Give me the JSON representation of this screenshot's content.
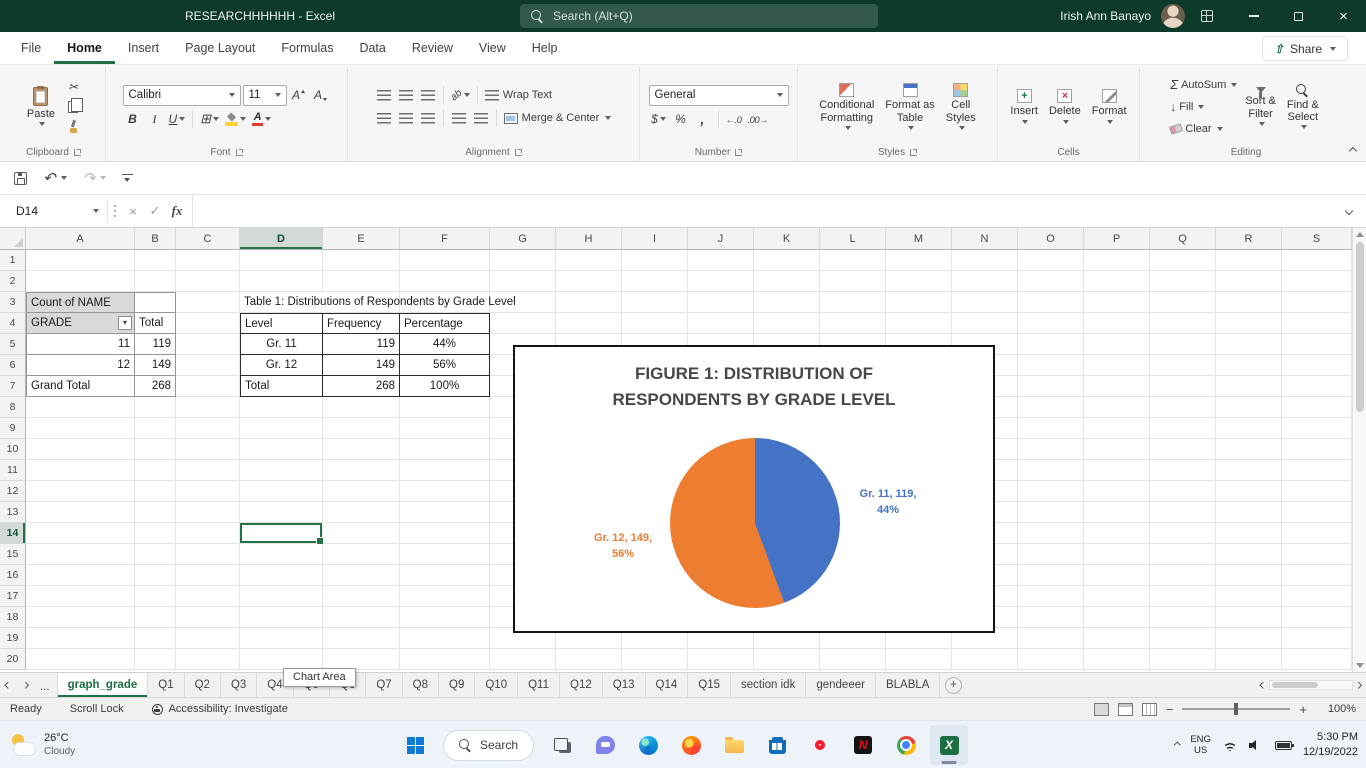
{
  "titlebar": {
    "title": "RESEARCHHHHHH  -  Excel",
    "search": "Search (Alt+Q)",
    "user": "Irish Ann Banayo"
  },
  "menu": {
    "tabs": [
      "File",
      "Home",
      "Insert",
      "Page Layout",
      "Formulas",
      "Data",
      "Review",
      "View",
      "Help"
    ],
    "active": "Home",
    "share": "Share"
  },
  "ribbon": {
    "paste": "Paste",
    "font_name": "Calibri",
    "font_size": "11",
    "wrap_text": "Wrap Text",
    "merge_center": "Merge & Center",
    "number_format": "General",
    "conditional_formatting": "Conditional\nFormatting",
    "format_as_table": "Format as\nTable",
    "cell_styles": "Cell\nStyles",
    "insert": "Insert",
    "delete": "Delete",
    "format": "Format",
    "autosum": "AutoSum",
    "fill": "Fill",
    "clear": "Clear",
    "sort_filter": "Sort &\nFilter",
    "find_select": "Find &\nSelect",
    "groups": {
      "clipboard": "Clipboard",
      "font": "Font",
      "alignment": "Alignment",
      "number": "Number",
      "styles": "Styles",
      "cells": "Cells",
      "editing": "Editing"
    }
  },
  "formula_bar": {
    "name_box": "D14"
  },
  "grid": {
    "columns": [
      "A",
      "B",
      "C",
      "D",
      "E",
      "F",
      "G",
      "H",
      "I",
      "J",
      "K",
      "L",
      "M",
      "N",
      "O",
      "P",
      "Q",
      "R",
      "S"
    ],
    "row_count": 20,
    "selected": {
      "col": "D",
      "row": 14
    },
    "cells": [
      {
        "ref": "A3",
        "text": "Count of NAME",
        "cls": "pv t l gray"
      },
      {
        "ref": "B3",
        "text": "",
        "cls": "pv t"
      },
      {
        "ref": "A4",
        "text": "GRADE",
        "cls": "pv l gray filter"
      },
      {
        "ref": "B4",
        "text": "Total",
        "cls": "pv"
      },
      {
        "ref": "A5",
        "text": "11",
        "cls": "pv l num"
      },
      {
        "ref": "B5",
        "text": "119",
        "cls": "pv num"
      },
      {
        "ref": "A6",
        "text": "12",
        "cls": "pv l num"
      },
      {
        "ref": "B6",
        "text": "149",
        "cls": "pv num"
      },
      {
        "ref": "A7",
        "text": "Grand Total",
        "cls": "pv l"
      },
      {
        "ref": "B7",
        "text": "268",
        "cls": "pv num"
      },
      {
        "ref": "D3",
        "text": "Table 1: Distributions of Respondents by Grade Level",
        "cls": "spill"
      },
      {
        "ref": "D4",
        "text": "Level",
        "cls": "tbl t l"
      },
      {
        "ref": "E4",
        "text": "Frequency",
        "cls": "tbl t"
      },
      {
        "ref": "F4",
        "text": "Percentage",
        "cls": "tbl t"
      },
      {
        "ref": "D5",
        "text": "Gr. 11",
        "cls": "tbl l center"
      },
      {
        "ref": "E5",
        "text": "119",
        "cls": "tbl num"
      },
      {
        "ref": "F5",
        "text": "44%",
        "cls": "tbl center"
      },
      {
        "ref": "D6",
        "text": "Gr. 12",
        "cls": "tbl l center"
      },
      {
        "ref": "E6",
        "text": "149",
        "cls": "tbl num"
      },
      {
        "ref": "F6",
        "text": "56%",
        "cls": "tbl center"
      },
      {
        "ref": "D7",
        "text": "Total",
        "cls": "tbl l"
      },
      {
        "ref": "E7",
        "text": "268",
        "cls": "tbl num"
      },
      {
        "ref": "F7",
        "text": "100%",
        "cls": "tbl center"
      }
    ]
  },
  "chart_data": {
    "type": "pie",
    "title": "FIGURE 1: DISTRIBUTION OF RESPONDENTS BY GRADE LEVEL",
    "categories": [
      "Gr. 11",
      "Gr. 12"
    ],
    "values": [
      119,
      149
    ],
    "percentages": [
      "44%",
      "56%"
    ],
    "colors": [
      "#4472C4",
      "#ED7D31"
    ],
    "legend_position": "none",
    "labels": {
      "gr11": "Gr. 11, 119,\n44%",
      "gr12": "Gr. 12, 149,\n56%"
    }
  },
  "sheet_tabs": {
    "overflow": "...",
    "tabs": [
      "graph_grade",
      "Q1",
      "Q2",
      "Q3",
      "Q4",
      "Q5",
      "Q6",
      "Q7",
      "Q8",
      "Q9",
      "Q10",
      "Q11",
      "Q12",
      "Q13",
      "Q14",
      "Q15",
      "section idk",
      "gendeeer",
      "BLABLA"
    ],
    "active": "graph_grade",
    "tooltip": "Chart Area"
  },
  "status_bar": {
    "ready": "Ready",
    "scroll_lock": "Scroll Lock",
    "accessibility": "Accessibility: Investigate",
    "zoom": "100%"
  },
  "taskbar": {
    "weather_temp": "26°C",
    "weather_desc": "Cloudy",
    "search": "Search",
    "lang_line1": "ENG",
    "lang_line2": "US",
    "time": "5:30 PM",
    "date": "12/19/2022"
  }
}
